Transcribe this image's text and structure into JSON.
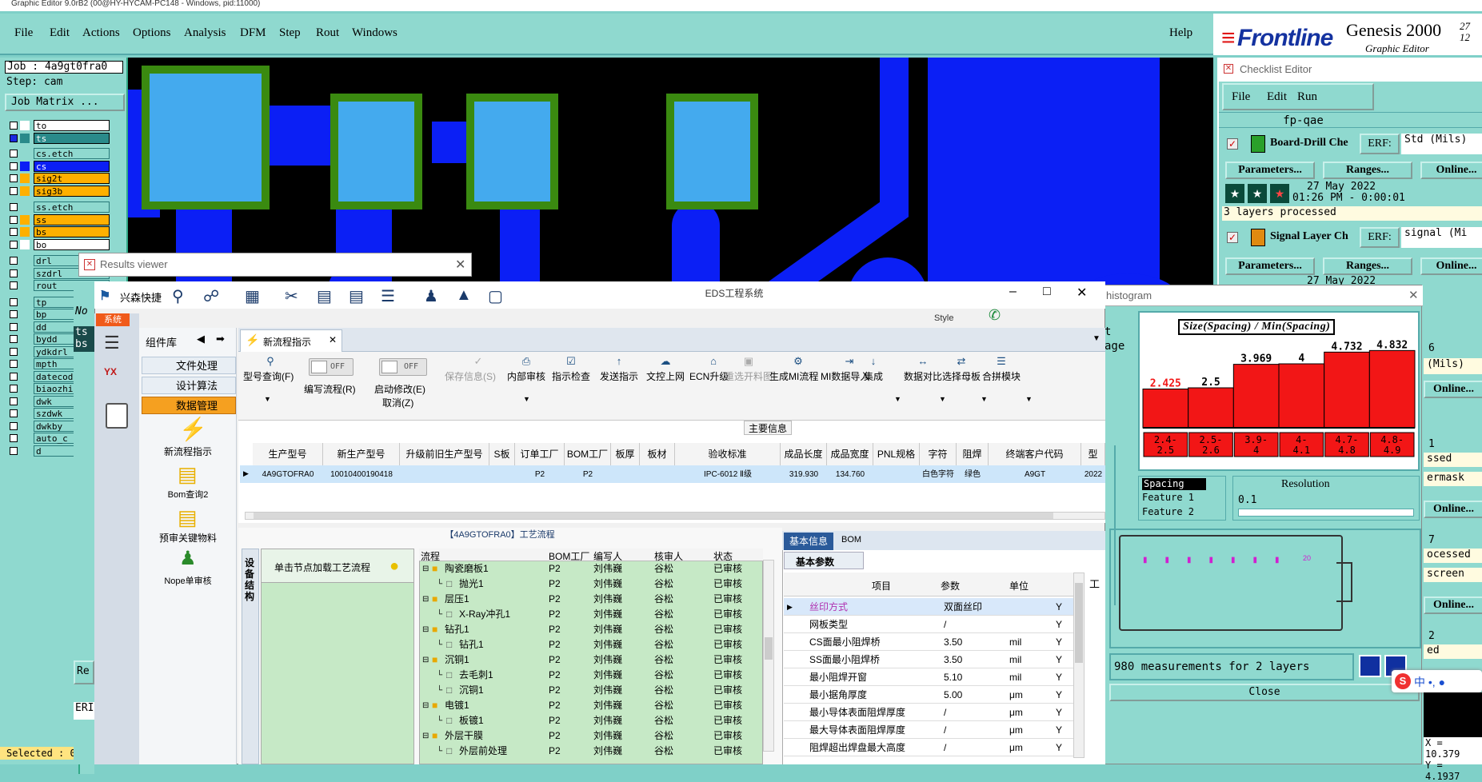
{
  "genesis": {
    "titlebar": "Graphic Editor 9.0rB2 (00@HY-HYCAM-PC148 - Windows, pid:11000)",
    "menu": [
      "File",
      "Edit",
      "Actions",
      "Options",
      "Analysis",
      "DFM",
      "Step",
      "Rout",
      "Windows"
    ],
    "help": "Help",
    "job": "Job : 4a9gt0fra0",
    "step": "Step: cam",
    "job_matrix": "Job Matrix ...",
    "layers": [
      {
        "name": "to",
        "color": "#ffffff"
      },
      {
        "name": "ts",
        "color": "#2a8a8a"
      },
      {
        "name": "cs.etch",
        "color": ""
      },
      {
        "name": "cs",
        "color": "#0b1ff5"
      },
      {
        "name": "sig2t",
        "color": "#ffb000"
      },
      {
        "name": "sig3b",
        "color": "#ffb000"
      },
      {
        "name": "ss.etch",
        "color": ""
      },
      {
        "name": "ss",
        "color": "#ffb000"
      },
      {
        "name": "bs",
        "color": "#ffb000"
      },
      {
        "name": "bo",
        "color": "#ffffff"
      },
      {
        "name": "drl",
        "color": ""
      },
      {
        "name": "szdrl",
        "color": ""
      },
      {
        "name": "rout",
        "color": ""
      },
      {
        "name": "tp",
        "color": ""
      },
      {
        "name": "bp",
        "color": ""
      },
      {
        "name": "dd",
        "color": ""
      },
      {
        "name": "bydd",
        "color": ""
      },
      {
        "name": "ydkdrl",
        "color": ""
      },
      {
        "name": "mpth",
        "color": ""
      },
      {
        "name": "datecode",
        "color": ""
      },
      {
        "name": "biaozhi",
        "color": ""
      },
      {
        "name": "dwk",
        "color": ""
      },
      {
        "name": "szdwk",
        "color": ""
      },
      {
        "name": "dwkby",
        "color": ""
      },
      {
        "name": "auto_c",
        "color": ""
      },
      {
        "name": "d",
        "color": ""
      }
    ],
    "selected": "Selected : 0",
    "left_partial": [
      "No",
      "ts",
      "bs",
      "Re",
      "ERI"
    ],
    "coords": {
      "x": "X = 10.379",
      "y": "Y = 4.1937"
    }
  },
  "brand": {
    "logo": "Frontline",
    "product": "Genesis 2000",
    "sub": "Graphic Editor",
    "date1": "27",
    "date2": "12"
  },
  "checklist": {
    "title": "Checklist Editor",
    "menu": [
      "File",
      "Edit",
      "Run"
    ],
    "name": "fp-qae",
    "items": [
      {
        "name": "Board-Drill Che",
        "erf": "ERF:",
        "erf_value": "Std (Mils)",
        "params": "Parameters...",
        "ranges": "Ranges...",
        "online": "Online...",
        "date": "27 May 2022",
        "time": "01:26 PM - 0:00:01",
        "status": "3 layers processed"
      },
      {
        "name": "Signal Layer Ch",
        "erf": "ERF:",
        "erf_value": "signal (Mi",
        "params": "Parameters...",
        "ranges": "Ranges...",
        "online": "Online...",
        "date": "27 May 2022"
      }
    ],
    "right_partial": [
      "6",
      "(Mils)",
      "Online...",
      "1",
      "ssed",
      "ermask",
      "Online...",
      "7",
      "ocessed",
      "screen",
      "Online...",
      "2",
      "ed"
    ]
  },
  "histogram": {
    "title": "histogram",
    "left_partial": [
      "t",
      "age"
    ],
    "chart_title": "Size(Spacing) / Min(Spacing)",
    "list": [
      "Spacing",
      "Feature 1",
      "Feature 2"
    ],
    "resolution_label": "Resolution",
    "resolution_value": "0.1",
    "measurements": "980 measurements for 2 layers",
    "close": "Close",
    "marker_label": "20"
  },
  "chart_data": {
    "type": "bar",
    "title": "Size(Spacing) / Min(Spacing)",
    "categories": [
      "2.4-2.5",
      "2.5-2.6",
      "3.9-4",
      "4-4.1",
      "4.7-4.8",
      "4.8-4.9"
    ],
    "values": [
      2.425,
      2.5,
      3.969,
      4,
      4.732,
      4.832
    ],
    "value_labels": [
      "2.425",
      "2.5",
      "3.969",
      "4",
      "4.732",
      "4.832"
    ],
    "cat_top": [
      "2.4-",
      "2.5-",
      "3.9-",
      "4-",
      "4.7-",
      "4.8-"
    ],
    "cat_bottom": [
      "2.5",
      "2.6",
      "4",
      "4.1",
      "4.8",
      "4.9"
    ],
    "ylim": [
      0,
      5.2
    ]
  },
  "results_viewer": {
    "title": "Results viewer"
  },
  "eds": {
    "brand": "兴森快捷",
    "title": "EDS工程系统",
    "style": "Style",
    "system_tab": "系统",
    "components": "组件库",
    "tab": "新流程指示",
    "nav": [
      "文件处理",
      "设计算法",
      "数据管理"
    ],
    "nav_tools": [
      "新流程指示",
      "Bom查询2",
      "预审关键物料",
      "Nope单审核"
    ],
    "toolbar": {
      "model_query": "型号查询(F)",
      "edit_flow": "编写流程(R)",
      "off1": "OFF",
      "start_modify": "启动修改(E)",
      "cancel": "取消(Z)",
      "off2": "OFF",
      "items": [
        "保存信息(S)",
        "内部审核",
        "指示检查",
        "发送指示",
        "文控上网",
        "ECN升级",
        "重选开料图",
        "生成MI流程",
        "MI数据导入",
        "集成",
        "数据对比",
        "选择母板",
        "合拼模块"
      ]
    },
    "main_info": "主要信息",
    "table": {
      "headers": [
        "生产型号",
        "新生产型号",
        "升级前旧生产型号",
        "S板",
        "订单工厂",
        "BOM工厂",
        "板厚",
        "板材",
        "验收标准",
        "成品长度",
        "成品宽度",
        "PNL规格",
        "字符",
        "阻焊",
        "终端客户代码",
        "型"
      ],
      "row": [
        "4A9GTOFRA0",
        "10010400190418",
        "",
        "",
        "P2",
        "P2",
        "",
        "",
        "IPC-6012 Ⅱ级",
        "319.930",
        "134.760",
        "",
        "白色字符",
        "绿色",
        "A9GT",
        "2022"
      ]
    },
    "flow_title": "【4A9GTOFRA0】工艺流程",
    "side_tab": "设备结构",
    "hint": "单击节点加载工艺流程",
    "flow_headers": [
      "流程",
      "BOM工厂",
      "编写人",
      "核审人",
      "状态"
    ],
    "flow_rows": [
      {
        "name": "陶瓷磨板1",
        "level": 0,
        "folder": true,
        "bom": "P2",
        "writer": "刘伟巍",
        "reviewer": "谷松",
        "status": "已审核"
      },
      {
        "name": "抛光1",
        "level": 1,
        "folder": false,
        "bom": "P2",
        "writer": "刘伟巍",
        "reviewer": "谷松",
        "status": "已审核"
      },
      {
        "name": "层压1",
        "level": 0,
        "folder": true,
        "bom": "P2",
        "writer": "刘伟巍",
        "reviewer": "谷松",
        "status": "已审核"
      },
      {
        "name": "X-Ray冲孔1",
        "level": 1,
        "folder": false,
        "bom": "P2",
        "writer": "刘伟巍",
        "reviewer": "谷松",
        "status": "已审核"
      },
      {
        "name": "钻孔1",
        "level": 0,
        "folder": true,
        "bom": "P2",
        "writer": "刘伟巍",
        "reviewer": "谷松",
        "status": "已审核"
      },
      {
        "name": "钻孔1",
        "level": 1,
        "folder": false,
        "bom": "P2",
        "writer": "刘伟巍",
        "reviewer": "谷松",
        "status": "已审核"
      },
      {
        "name": "沉铜1",
        "level": 0,
        "folder": true,
        "bom": "P2",
        "writer": "刘伟巍",
        "reviewer": "谷松",
        "status": "已审核"
      },
      {
        "name": "去毛刺1",
        "level": 1,
        "folder": false,
        "bom": "P2",
        "writer": "刘伟巍",
        "reviewer": "谷松",
        "status": "已审核"
      },
      {
        "name": "沉铜1",
        "level": 1,
        "folder": false,
        "bom": "P2",
        "writer": "刘伟巍",
        "reviewer": "谷松",
        "status": "已审核"
      },
      {
        "name": "电镀1",
        "level": 0,
        "folder": true,
        "bom": "P2",
        "writer": "刘伟巍",
        "reviewer": "谷松",
        "status": "已审核"
      },
      {
        "name": "板镀1",
        "level": 1,
        "folder": false,
        "bom": "P2",
        "writer": "刘伟巍",
        "reviewer": "谷松",
        "status": "已审核"
      },
      {
        "name": "外层干膜",
        "level": 0,
        "folder": true,
        "bom": "P2",
        "writer": "刘伟巍",
        "reviewer": "谷松",
        "status": "已审核"
      },
      {
        "name": "外层前处理",
        "level": 1,
        "folder": false,
        "bom": "P2",
        "writer": "刘伟巍",
        "reviewer": "谷松",
        "status": "已审核"
      }
    ],
    "info_tabs": [
      "基本信息",
      "BOM"
    ],
    "params_tab": "基本参数",
    "param_headers": [
      "项目",
      "参数",
      "单位"
    ],
    "params": [
      {
        "item": "丝印方式",
        "value": "双面丝印",
        "unit": "",
        "flag": "Y"
      },
      {
        "item": "网板类型",
        "value": "/",
        "unit": "",
        "flag": "Y"
      },
      {
        "item": "CS面最小阻焊桥",
        "value": "3.50",
        "unit": "mil",
        "flag": "Y"
      },
      {
        "item": "SS面最小阻焊桥",
        "value": "3.50",
        "unit": "mil",
        "flag": "Y"
      },
      {
        "item": "最小阻焊开窗",
        "value": "5.10",
        "unit": "mil",
        "flag": "Y"
      },
      {
        "item": "最小据角厚度",
        "value": "5.00",
        "unit": "μm",
        "flag": "Y"
      },
      {
        "item": "最小导体表面阻焊厚度",
        "value": "/",
        "unit": "μm",
        "flag": "Y"
      },
      {
        "item": "最大导体表面阻焊厚度",
        "value": "/",
        "unit": "μm",
        "flag": "Y"
      },
      {
        "item": "阻焊超出焊盘最大高度",
        "value": "/",
        "unit": "μm",
        "flag": "Y"
      }
    ],
    "right_stub": "工"
  }
}
